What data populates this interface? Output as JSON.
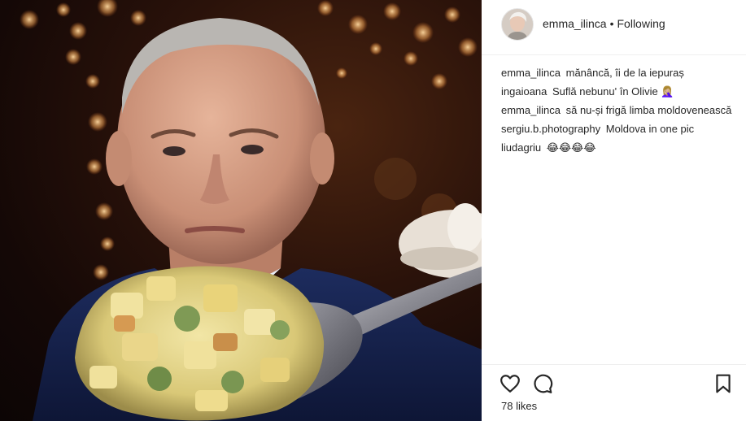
{
  "post": {
    "author": "emma_ilinca",
    "separator": "•",
    "follow_status": "Following",
    "likes": "78 likes"
  },
  "comments": [
    {
      "user": "emma_ilinca",
      "text": "mănâncă, îi de la iepuraș"
    },
    {
      "user": "ingaioana",
      "text": "Suflă nebunu' în Olivie 🤦🏼‍♀️"
    },
    {
      "user": "emma_ilinca",
      "text": "să nu-și frigă limba moldovenească"
    },
    {
      "user": "sergiu.b.photography",
      "text": "Moldova in one pic"
    },
    {
      "user": "liudagriu",
      "text": "😂😂😂😂"
    }
  ],
  "icons": {
    "like": "heart-icon",
    "comment": "comment-icon",
    "save": "bookmark-icon"
  },
  "colors": {
    "text": "#262626",
    "divider": "#efefef",
    "background": "#ffffff"
  }
}
